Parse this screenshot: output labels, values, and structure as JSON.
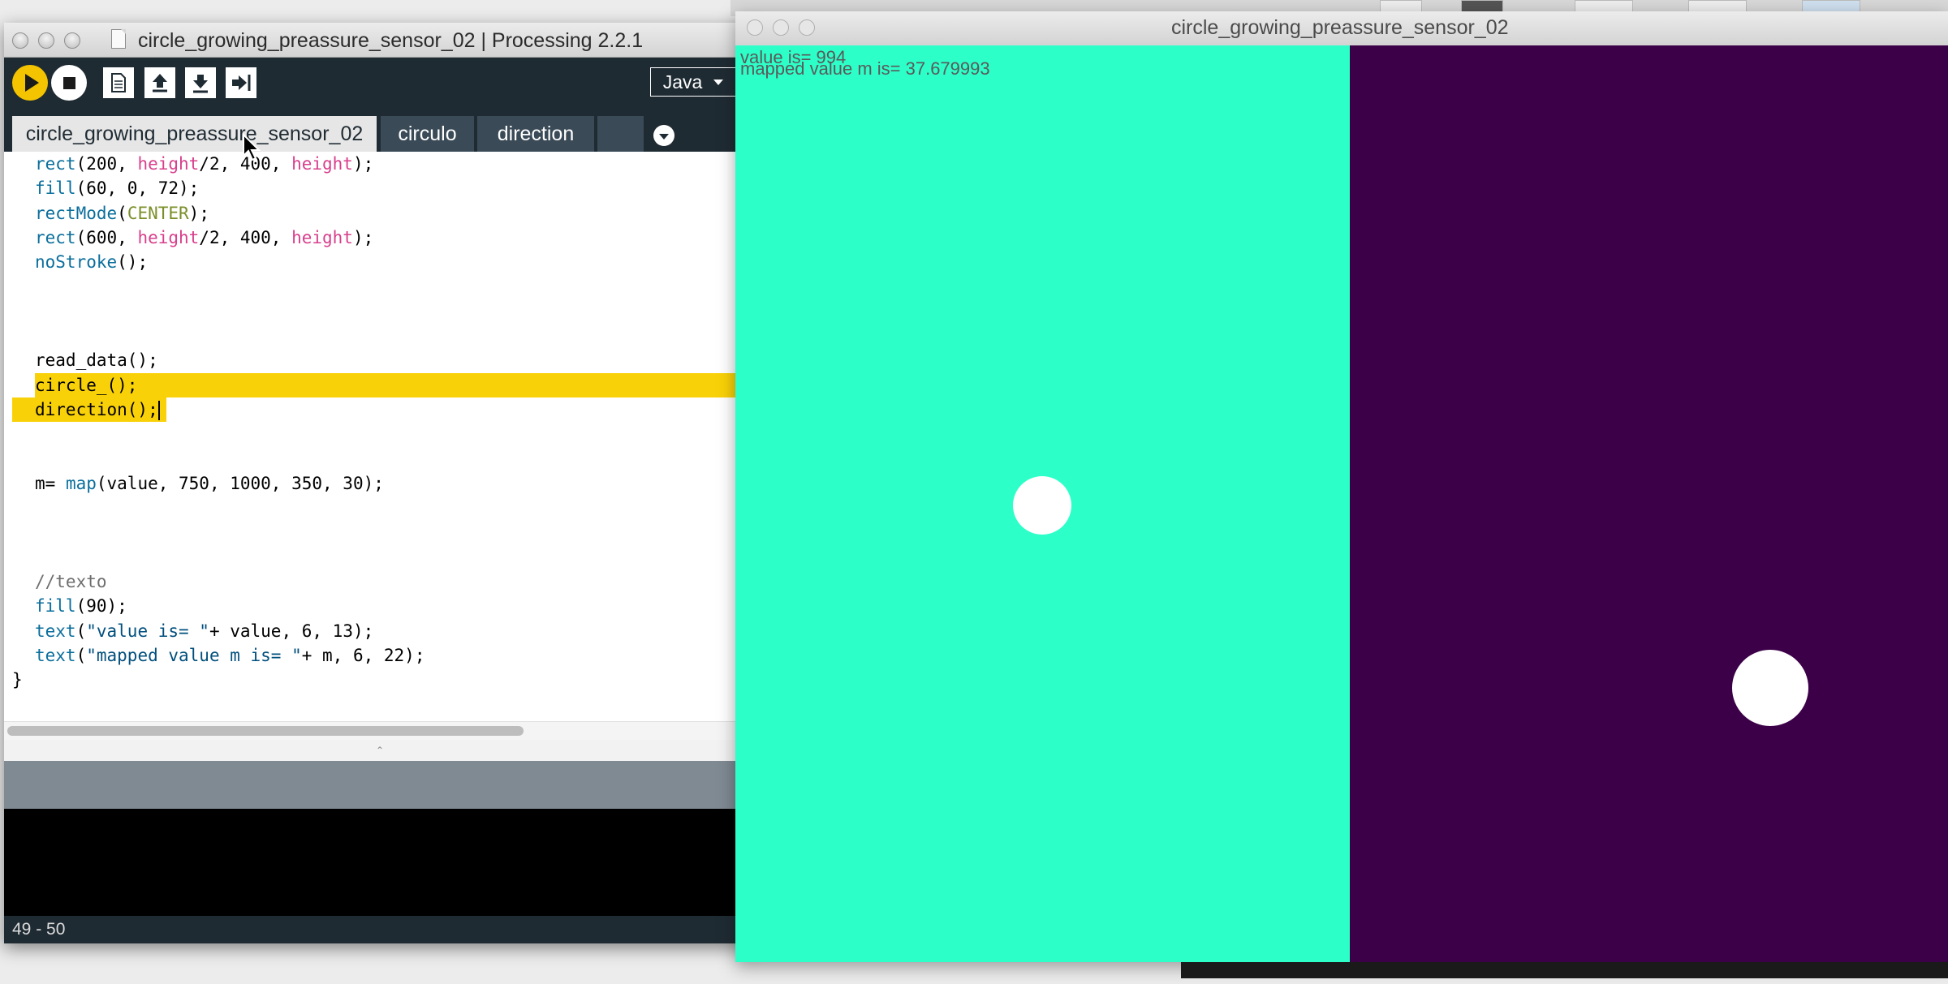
{
  "editor": {
    "title": "circle_growing_preassure_sensor_02 | Processing 2.2.1",
    "toolbar": {
      "run_icon": "play-icon",
      "stop_icon": "stop-icon",
      "new_icon": "new-sketch-icon",
      "open_icon": "open-arrow-up-icon",
      "save_icon": "save-arrow-down-icon",
      "export_icon": "export-arrow-right-icon",
      "mode_label": "Java"
    },
    "tabs": [
      {
        "label": "circle_growing_preassure_sensor_02",
        "active": true
      },
      {
        "label": "circulo",
        "active": false
      },
      {
        "label": "direction",
        "active": false
      }
    ],
    "code_lines": [
      "rect(200, height/2, 400, height);",
      "fill(60, 0, 72);",
      "rectMode(CENTER);",
      "rect(600, height/2, 400, height);",
      "noStroke();",
      "",
      "",
      "",
      "read_data();",
      "circle_();",
      "direction();",
      "",
      "",
      "m= map(value, 750, 1000, 350, 30);",
      "",
      "",
      "",
      "//texto",
      "fill(90);",
      "text(\"value is= \"+ value, 6, 13);",
      "text(\"mapped value m is= \"+ m, 6, 22);",
      "}"
    ],
    "line_indicator": "49 - 50"
  },
  "sketch": {
    "title": "circle_growing_preassure_sensor_02",
    "value_text": "value is= 994",
    "mapped_text": "mapped value m is= 37.679993",
    "left_color": "#2dffc8",
    "right_color": "#3c0048"
  }
}
